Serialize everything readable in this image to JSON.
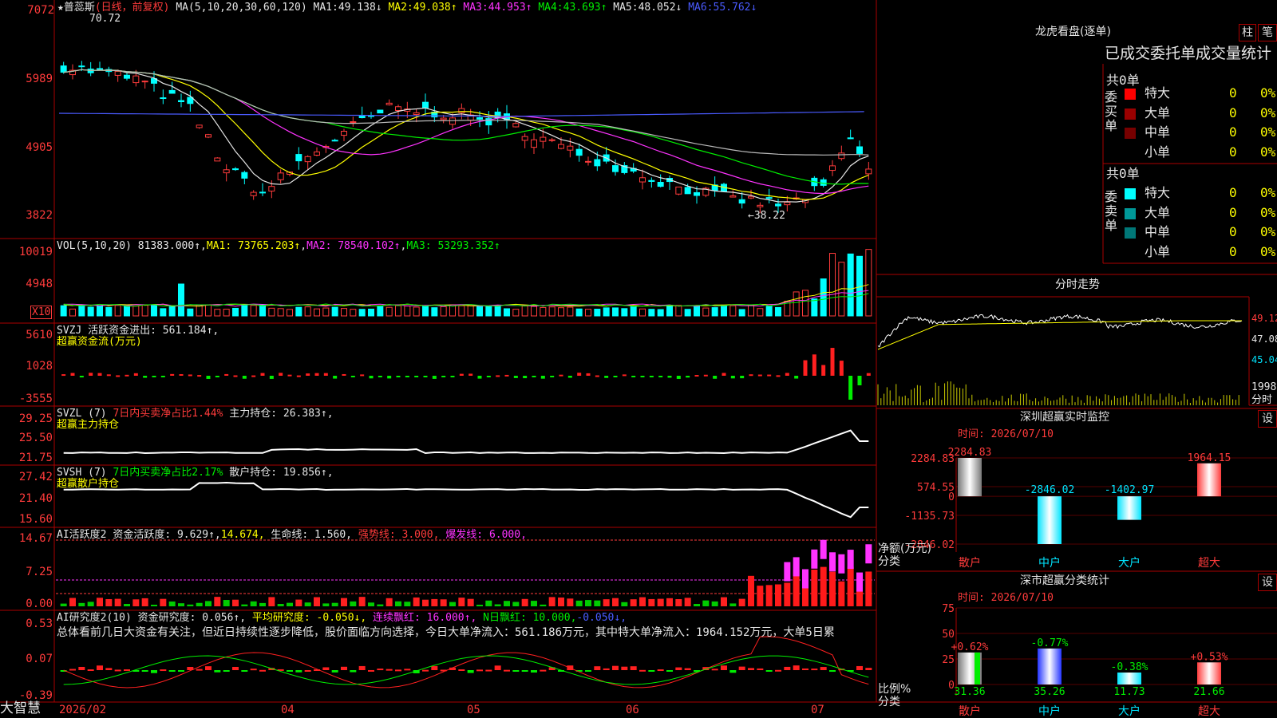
{
  "header": {
    "stock_name": "★普蕊斯",
    "period_tag": "(日线，前复权)",
    "ma_spec": "MA(5,10,20,30,60,120)",
    "ma": [
      {
        "label": "MA1:",
        "value": "49.138↓",
        "color": "#e6e6e6"
      },
      {
        "label": "MA2:",
        "value": "49.038↑",
        "color": "#ffff00"
      },
      {
        "label": "MA3:",
        "value": "44.953↑",
        "color": "#ff33ff"
      },
      {
        "label": "MA4:",
        "value": "43.693↑",
        "color": "#00ee00"
      },
      {
        "label": "MA5:",
        "value": "48.052↓",
        "color": "#d0d0d0"
      },
      {
        "label": "MA6:",
        "value": "55.762↓",
        "color": "#4a5bff"
      }
    ],
    "high_mark": "70.72",
    "low_mark": "←38.22"
  },
  "price_axis": [
    "7072",
    "5989",
    "4905",
    "3822"
  ],
  "vol": {
    "title": "VOL(5,10,20)",
    "value": "81383.000↑",
    "ma": [
      "MA1: 73765.203↑",
      "MA2: 78540.102↑",
      "MA3: 53293.352↑"
    ],
    "axis": [
      "10019",
      "4948"
    ],
    "unit": "X10"
  },
  "svzj": {
    "title": "SVZJ  活跃资金进出: 561.184↑,",
    "subtitle": "超赢资金流(万元)",
    "axis": [
      "5610",
      "1028",
      "-3555"
    ]
  },
  "svzl": {
    "title": "SVZL (7)",
    "ratio": "7日内买卖净占比1.44%",
    "hold": "主力持仓: 26.383↑,",
    "subtitle": "超赢主力持仓",
    "axis": [
      "29.25",
      "25.50",
      "21.75"
    ]
  },
  "svsh": {
    "title": "SVSH (7)",
    "ratio": "7日内买卖净占比2.17%",
    "hold": "散户持仓: 19.856↑,",
    "subtitle": "超赢散户持仓",
    "axis": [
      "27.42",
      "21.40",
      "15.60"
    ]
  },
  "ai_act": {
    "title": "AI活跃度2",
    "a": "资金活跃度: 9.629↑,",
    "b": "14.674,",
    "c": "生命线: 1.560,",
    "d": "强势线: 3.000,",
    "e": "爆发线: 6.000,",
    "axis": [
      "14.67",
      "7.25",
      "0.00"
    ]
  },
  "ai_res": {
    "title": "AI研究度2(10)",
    "a": "资金研究度: 0.056↑,",
    "b": "平均研究度: -0.050↓,",
    "c": "连续飘红: 16.000↑,",
    "d": "N日飘红: 10.000,",
    "e": "-0.050↓,",
    "summary": "总体看前几日大资金有关注，但近日持续性逐步降低，股价面临方向选择，今日大单净流入：561.186万元，其中特大单净流入：1964.152万元，大单5日累",
    "axis": [
      "0.53",
      "0.07",
      "-0.39"
    ]
  },
  "xaxis": {
    "labels": [
      "2026/02",
      "04",
      "05",
      "06",
      "07"
    ],
    "brand": "大智慧"
  },
  "right": {
    "lhkp_title": "龙虎看盘(逐单)",
    "btn_zhu": "柱",
    "btn_bi": "笔",
    "tabs_text": "已成交委托单成交量统计",
    "buy": {
      "side": "委买单",
      "total": "共0单",
      "rows": [
        [
          "特大",
          "0",
          "0%"
        ],
        [
          "大单",
          "0",
          "0%"
        ],
        [
          "中单",
          "0",
          "0%"
        ],
        [
          "小单",
          "0",
          "0%"
        ]
      ]
    },
    "sell": {
      "side": "委卖单",
      "total": "共0单",
      "rows": [
        [
          "特大",
          "0",
          "0%"
        ],
        [
          "大单",
          "0",
          "0%"
        ],
        [
          "中单",
          "0",
          "0%"
        ],
        [
          "小单",
          "0",
          "0%"
        ]
      ]
    },
    "fenshi_title": "分时走势",
    "fenshi_axis": [
      "49.12",
      "47.08",
      "45.04",
      "1998",
      "分时"
    ],
    "monitor_title": "深圳超赢实时监控",
    "monitor_time": "时间: 2026/07/10",
    "set1": "设",
    "monitor_axis": [
      "2284.83",
      "574.55",
      "0",
      "-1135.73",
      "-2846.02"
    ],
    "monitor_unit": "净额(万元)",
    "monitor_unit2": "分类",
    "stats_title": "深市超赢分类统计",
    "stats_time": "时间: 2026/07/10",
    "set2": "设",
    "stats_axis": [
      "75",
      "50",
      "25",
      "0"
    ],
    "stats_unit": "比例%",
    "stats_unit2": "分类",
    "cats": [
      "散户",
      "中户",
      "大户",
      "超大"
    ]
  },
  "chart_data": [
    {
      "type": "bar",
      "title": "深圳超赢实时监控",
      "categories": [
        "散户",
        "中户",
        "大户",
        "超大"
      ],
      "values": [
        2284.83,
        -2846.02,
        -1402.97,
        1964.15
      ],
      "ylim": [
        -2846.02,
        2284.83
      ],
      "ylabel": "净额(万元)",
      "colors": [
        "#bbbbbb",
        "#00e5ff",
        "#00e5ff",
        "#ff3b3b"
      ]
    },
    {
      "type": "bar",
      "title": "深市超赢分类统计",
      "categories": [
        "散户",
        "中户",
        "大户",
        "超大"
      ],
      "values": [
        31.36,
        35.26,
        11.73,
        21.66
      ],
      "changes": [
        "+0.62%",
        "-0.77%",
        "-0.38%",
        "+0.53%"
      ],
      "ylim": [
        0,
        75
      ],
      "ylabel": "比例%",
      "colors": [
        "#bbbbbb",
        "#3344ff",
        "#00e5ff",
        "#ff3b3b"
      ]
    }
  ]
}
